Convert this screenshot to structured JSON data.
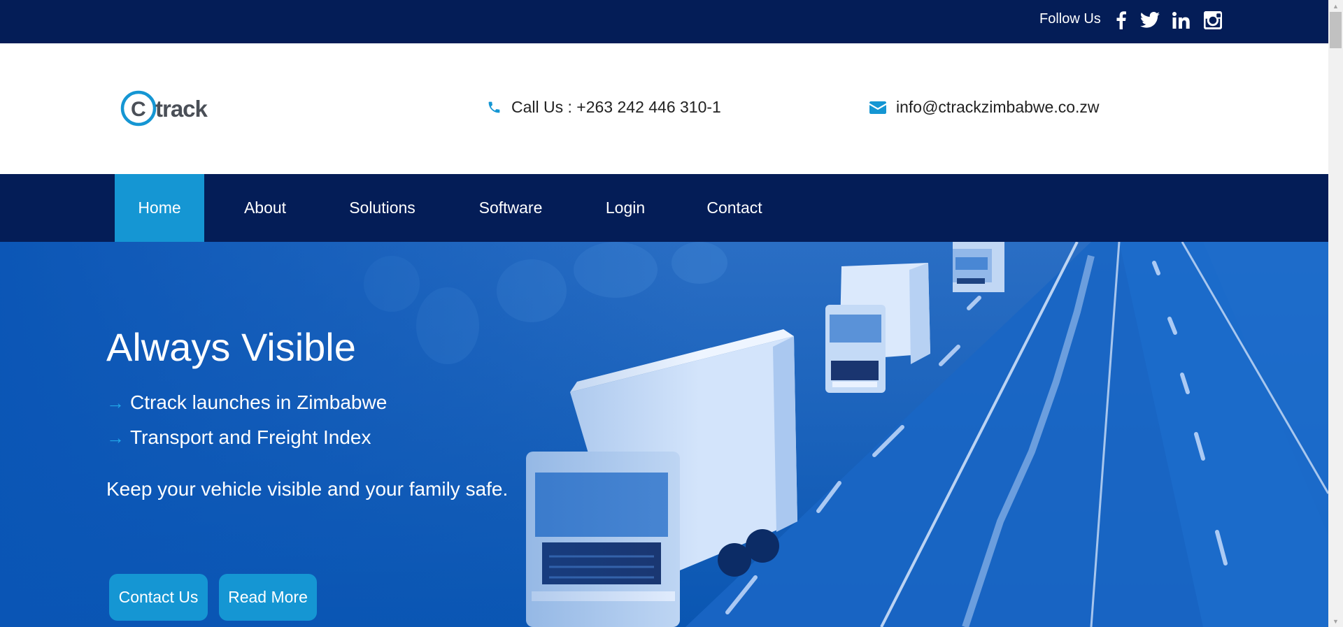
{
  "topbar": {
    "follow_label": "Follow Us",
    "social": [
      "facebook-icon",
      "twitter-icon",
      "linkedin-icon",
      "instagram-icon"
    ]
  },
  "header": {
    "logo_text": "track",
    "logo_letter": "C",
    "phone": "Call Us : +263 242 446 310-1",
    "email": "info@ctrackzimbabwe.co.zw"
  },
  "nav": {
    "items": [
      "Home",
      "About",
      "Solutions",
      "Software",
      "Login",
      "Contact"
    ],
    "active": "Home"
  },
  "hero": {
    "title": "Always Visible",
    "items": [
      "Ctrack launches in Zimbabwe",
      "Transport and Freight Index"
    ],
    "subtitle": "Keep your vehicle visible and your family safe.",
    "buttons": [
      "Contact Us",
      "Read More"
    ]
  },
  "colors": {
    "navy": "#041d57",
    "accent": "#1596d3",
    "hero_blue": "#0b5bb8"
  }
}
